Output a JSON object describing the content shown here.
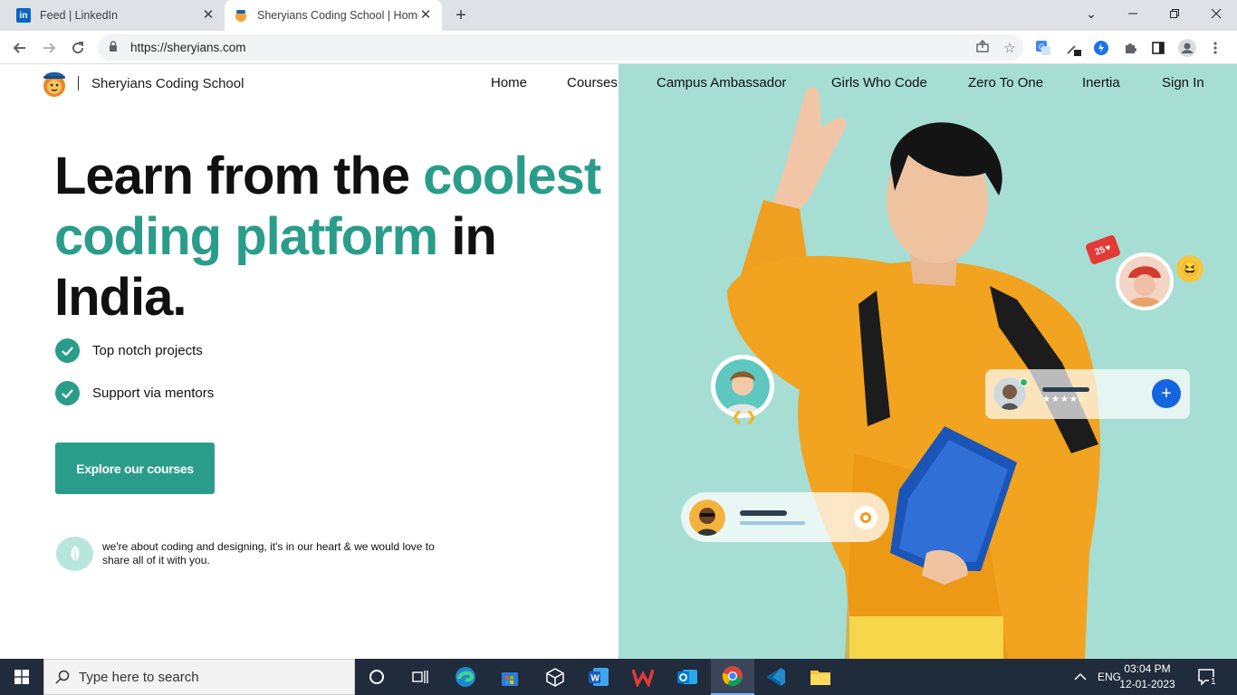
{
  "browser": {
    "tabs": [
      {
        "title": "Feed | LinkedIn",
        "active": false
      },
      {
        "title": "Sheryians Coding School | Home",
        "active": true
      }
    ],
    "new_tab": "+",
    "url": "https://sheryians.com"
  },
  "site": {
    "brand_name": "Sheryians Coding School",
    "nav": [
      "Home",
      "Courses",
      "Campus Ambassador",
      "Girls Who Code",
      "Zero To One",
      "Inertia",
      "Sign In"
    ],
    "headline": {
      "part1": "Learn from the ",
      "accent1": "coolest",
      "accent2": "coding platform",
      "part2": " in",
      "part3": "India."
    },
    "features": [
      "Top notch projects",
      "Support via mentors"
    ],
    "cta": "Explore our courses",
    "about_text": "we're about coding and designing, it's in our heart & we would love to share all of it with you.",
    "badge_count": "25",
    "accent_color": "#2a9d8a",
    "hero_bg_color": "#a6ded4"
  },
  "taskbar": {
    "search_placeholder": "Type here to search",
    "language": "ENG",
    "time": "03:04 PM",
    "date": "12-01-2023",
    "notification_count": "1"
  }
}
